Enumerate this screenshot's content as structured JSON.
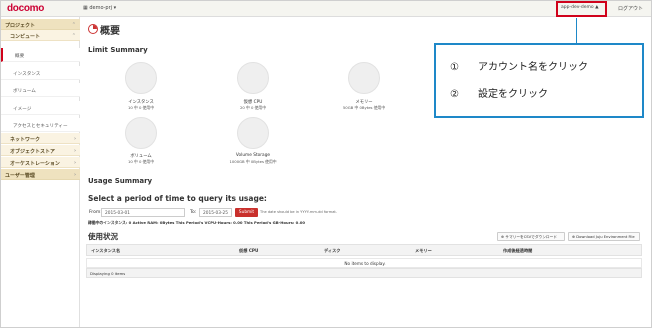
{
  "header": {
    "logo": "docomo",
    "project": "demo-prj ▾",
    "account": "app-dev-demo ▲",
    "logout": "ログアウト"
  },
  "sidebar": {
    "project_label": "プロジェクト",
    "compute_label": "コンピュート",
    "items": [
      "概要",
      "インスタンス",
      "ボリューム",
      "イメージ",
      "アクセスとセキュリティー"
    ],
    "network_label": "ネットワーク",
    "object_store_label": "オブジェクトストア",
    "orchestration_label": "オーケストレーション",
    "user_mgmt_label": "ユーザー管理"
  },
  "main": {
    "title": "概要",
    "limit_heading": "Limit Summary",
    "limits": [
      {
        "label": "インスタンス",
        "detail": "10 中 0 使用中"
      },
      {
        "label": "仮想 CPU",
        "detail": "20 中 0 使用中"
      },
      {
        "label": "メモリー",
        "detail": "50GB 中 0Bytes 使用中"
      },
      {
        "label": "ボリューム",
        "detail": "10 中 0 使用中"
      },
      {
        "label": "Volume Storage",
        "detail": "1000GB 中 0Bytes 使用中"
      }
    ],
    "usage_heading": "Usage Summary",
    "period_heading": "Select a period of time to query its usage:",
    "from_label": "From:",
    "from_value": "2015-03-01",
    "to_label": "To:",
    "to_value": "2015-03-25",
    "submit_label": "Submit",
    "hint": "The date should be in YYYY-mm-dd format.",
    "summary_line": "稼働中のインスタンス: 0 Active RAM: 0Bytes This Period's VCPU-Hours: 0.00 This Period's GB-Hours: 0.00",
    "used_heading": "使用状況",
    "csv_button": "サマリーをCSVでダウンロード",
    "env_button": "Download Juju Environment File",
    "table": {
      "columns": [
        "インスタンス名",
        "仮想 CPU",
        "ディスク",
        "メモリー",
        "作成後経過時間"
      ],
      "empty_text": "No items to display.",
      "footer": "Displaying 0 items"
    }
  },
  "callout": {
    "steps": [
      {
        "num": "①",
        "text": "アカウント名をクリック"
      },
      {
        "num": "②",
        "text": "設定をクリック"
      }
    ]
  },
  "colors": {
    "brand": "#cc0033",
    "sidebar_category": "#efe2bf",
    "submit": "#c9302c",
    "highlight_box": "#d0021b",
    "callout_border": "#1e88c8"
  }
}
